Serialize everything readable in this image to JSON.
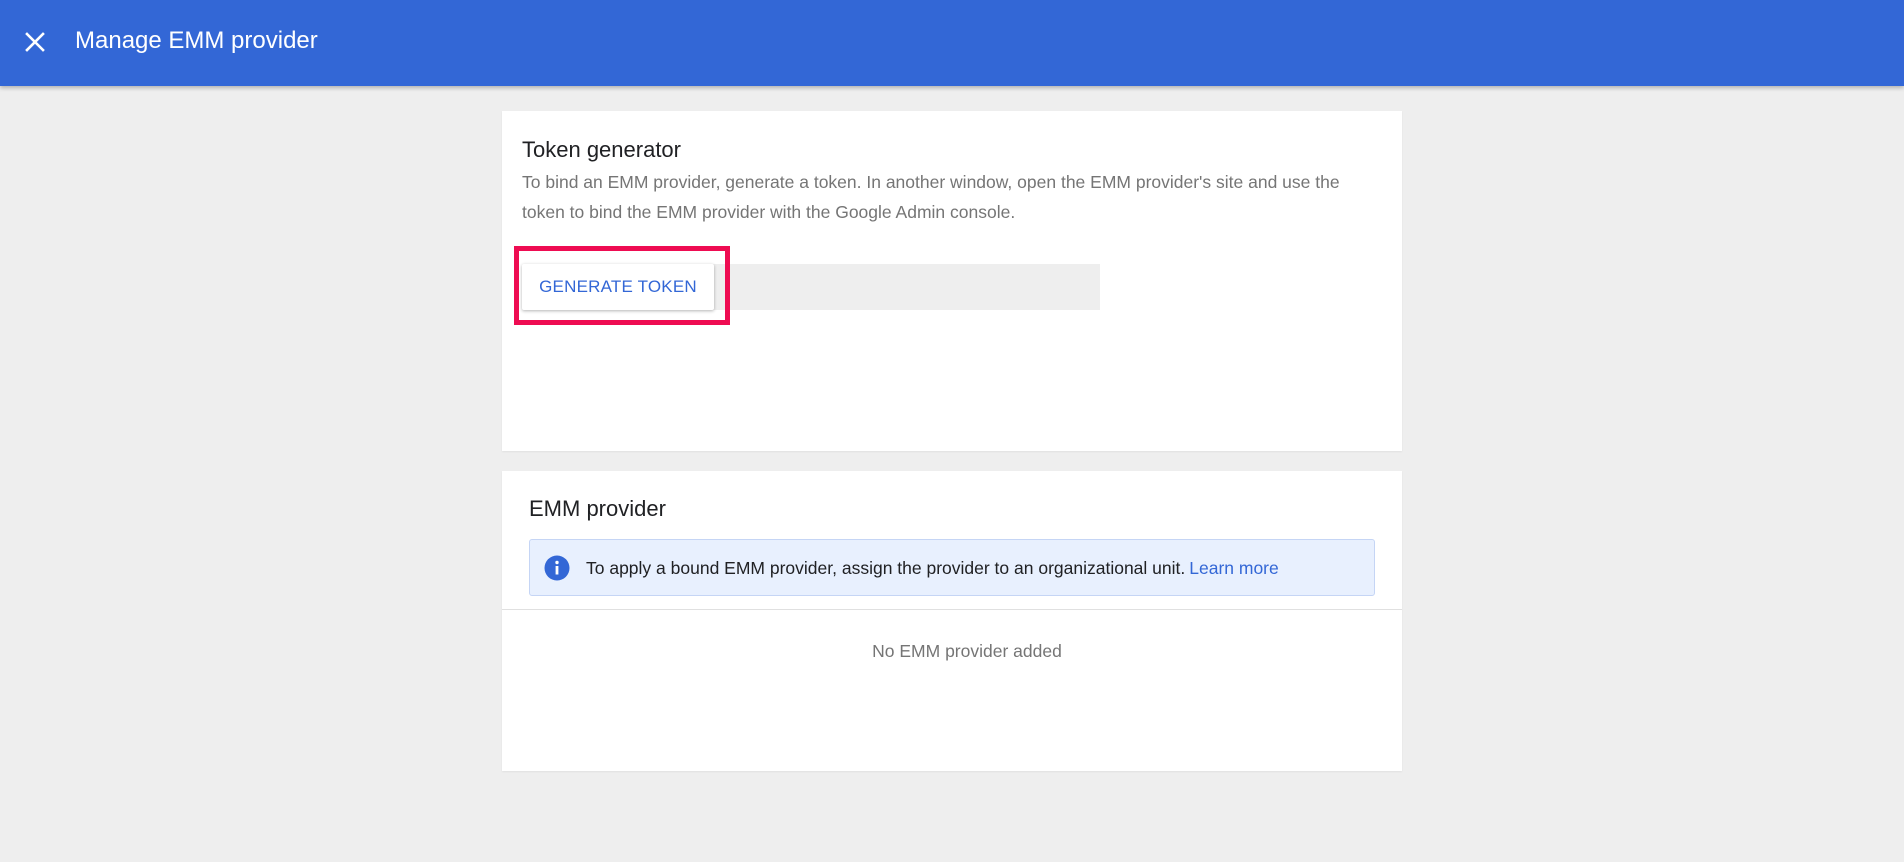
{
  "header": {
    "title": "Manage EMM provider",
    "close_icon": "close-icon",
    "background_color": "#3367d6"
  },
  "token_generator": {
    "title": "Token generator",
    "description": "To bind an EMM provider, generate a token. In another window, open the EMM provider's site and use the token to bind the EMM provider with the Google Admin console.",
    "button_label": "GENERATE TOKEN",
    "token_value": "",
    "highlight_color": "#ee0c52"
  },
  "emm_provider": {
    "title": "EMM provider",
    "info_icon": "info-icon",
    "info_text": "To apply a bound EMM provider, assign the provider to an organizational unit.",
    "learn_more_label": "Learn more",
    "empty_text": "No EMM provider added"
  }
}
